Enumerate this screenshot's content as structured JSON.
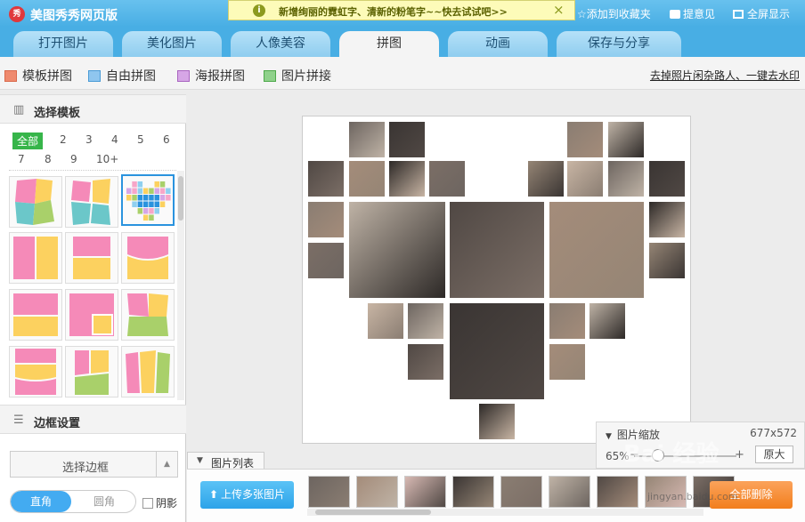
{
  "titlebar": {
    "logo_text": "秀",
    "app_title": "美图秀秀网页版",
    "banner_text": "新增绚丽的霓虹字、清新的粉笔字~~快去试试吧>>",
    "banner_close": "×",
    "links": [
      "添加到收藏夹",
      "提意见",
      "全屏显示"
    ]
  },
  "tabs": [
    {
      "label": "打开图片"
    },
    {
      "label": "美化图片"
    },
    {
      "label": "人像美容"
    },
    {
      "label": "拼图",
      "active": true
    },
    {
      "label": "动画"
    },
    {
      "label": "保存与分享"
    }
  ],
  "subtabs": [
    "模板拼图",
    "自由拼图",
    "海报拼图",
    "图片拼接"
  ],
  "subtabs_right": "去掉照片闲杂路人、一键去水印",
  "left_panel": {
    "template_header": "选择模板",
    "filters": [
      "全部",
      "2",
      "3",
      "4",
      "5",
      "6",
      "7",
      "8",
      "9",
      "10+"
    ],
    "border_header": "边框设置",
    "border_select": "选择边框",
    "corner_on": "直角",
    "corner_off": "圆角",
    "shadow_label": "阴影"
  },
  "zoom": {
    "header": "图片缩放",
    "size": "677x572",
    "percent": "65%",
    "original": "原大",
    "minus": "−",
    "plus": "+",
    "level": 0.65
  },
  "image_list": {
    "tab_label": "图片列表",
    "upload_button": "上传多张图片",
    "delete_button": "全部删除"
  },
  "watermark": {
    "text": "Bai 经验",
    "sub": "jingyan.baidu.com"
  },
  "colors": {
    "header_blue": "#48aee4",
    "active_green": "#37b54a",
    "upload_blue": "#2da3e9",
    "delete_orange": "#f27e1c",
    "template_pink": "#f58ab8",
    "template_yellow": "#fcd15f",
    "template_green": "#a9d06a",
    "template_teal": "#6bc7c9"
  }
}
